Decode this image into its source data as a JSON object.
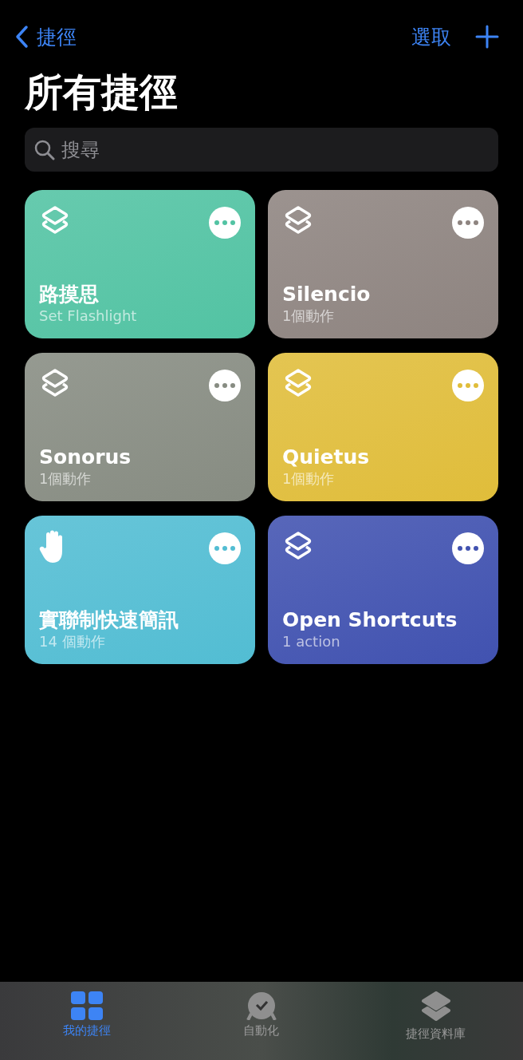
{
  "nav": {
    "back_label": "捷徑",
    "select_label": "選取"
  },
  "title": "所有捷徑",
  "search": {
    "placeholder": "搜尋"
  },
  "shortcuts": [
    {
      "name": "路摸思",
      "subtitle": "Set Flashlight",
      "color": "#52c3a3",
      "kind": "layers"
    },
    {
      "name": "Silencio",
      "subtitle": "1個動作",
      "color": "#8e8480",
      "kind": "layers"
    },
    {
      "name": "Sonorus",
      "subtitle": "1個動作",
      "color": "#878c82",
      "kind": "layers"
    },
    {
      "name": "Quietus",
      "subtitle": "1個動作",
      "color": "#e0bd3a",
      "kind": "layers"
    },
    {
      "name": "實聯制快速簡訊",
      "subtitle": "14 個動作",
      "color": "#52bdd3",
      "kind": "hand"
    },
    {
      "name": "Open Shortcuts",
      "subtitle": "1 action",
      "color": "#4152b0",
      "kind": "layers"
    }
  ],
  "tabs": [
    {
      "label": "我的捷徑",
      "selected": true
    },
    {
      "label": "自動化",
      "selected": false
    },
    {
      "label": "捷徑資料庫",
      "selected": false
    }
  ]
}
